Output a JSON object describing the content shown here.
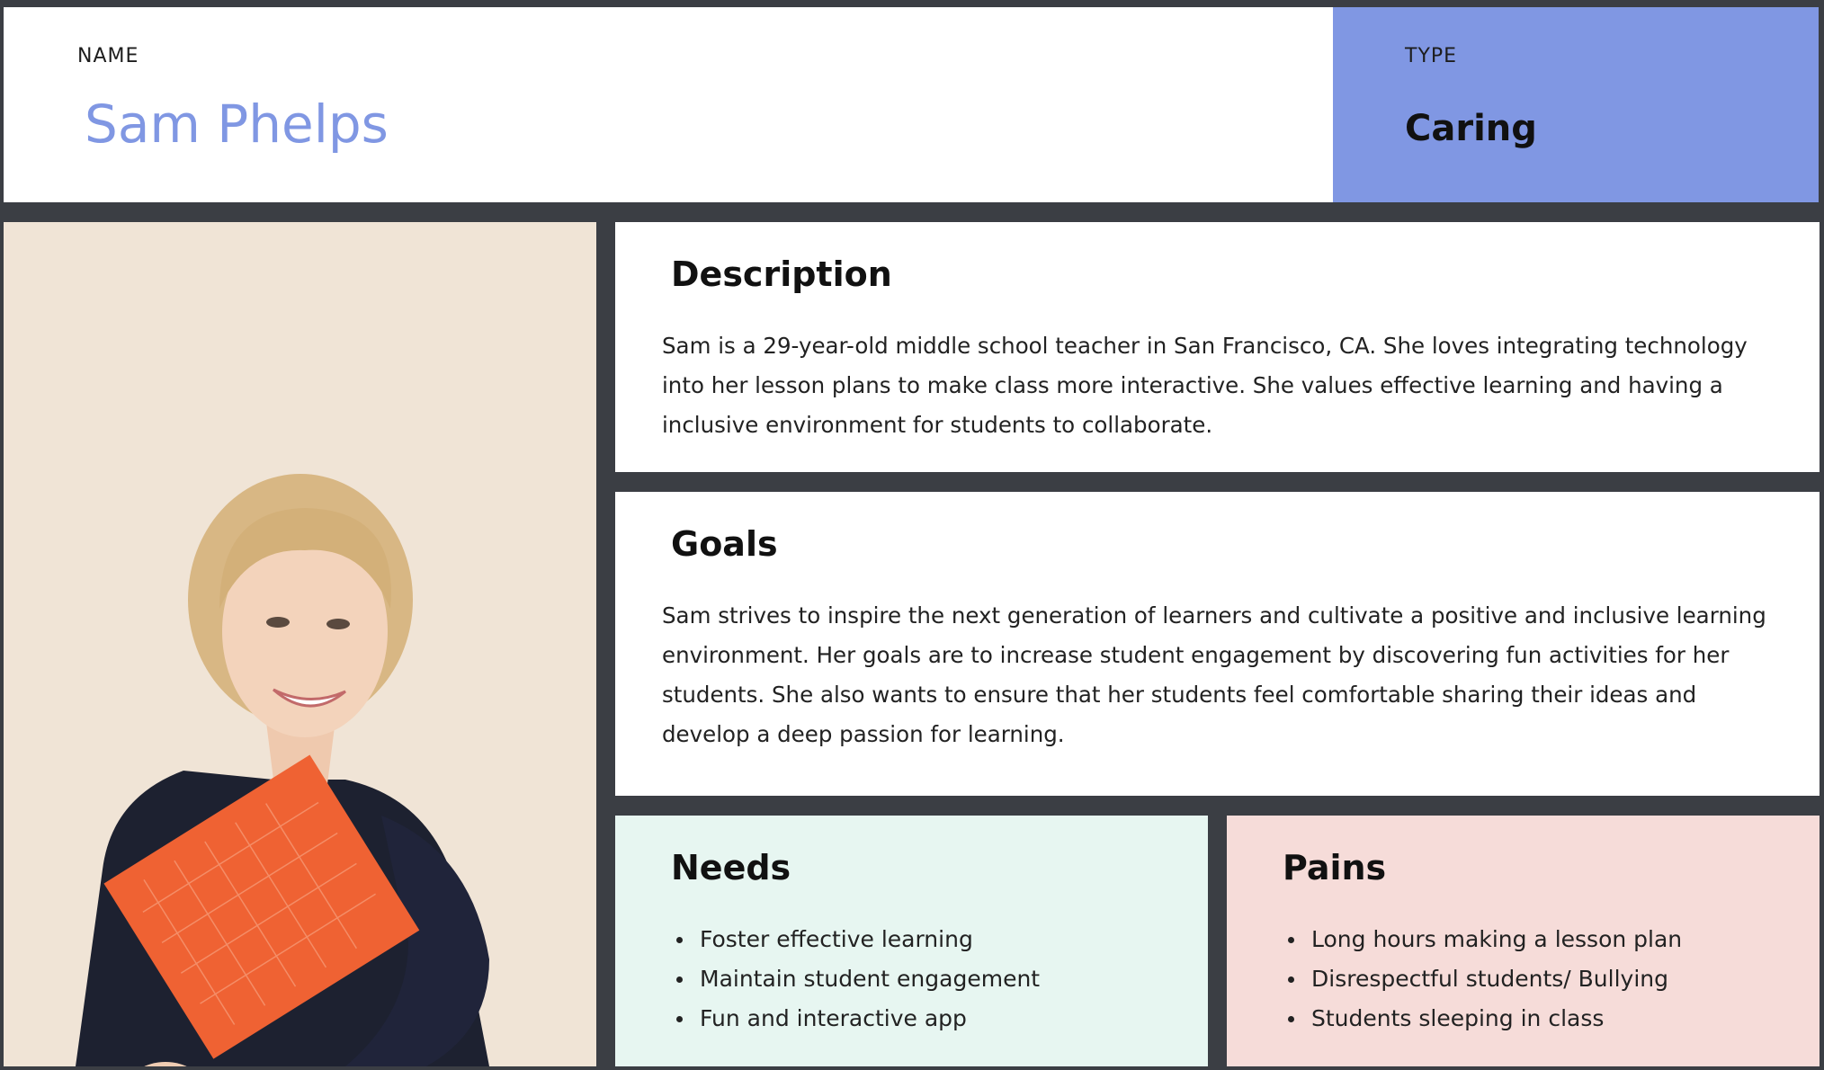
{
  "header": {
    "name_label": "NAME",
    "name_value": "Sam Phelps",
    "type_label": "TYPE",
    "type_value": "Caring"
  },
  "description": {
    "heading": "Description",
    "body": "Sam is a 29-year-old middle school teacher in San Francisco, CA. She loves integrating technology into her lesson plans to make class more interactive. She values effective learning and having a inclusive environment for students to collaborate."
  },
  "goals": {
    "heading": "Goals",
    "body": "Sam strives to inspire the next generation of learners and cultivate a positive and inclusive learning environment. Her goals are to increase student engagement by discovering fun activities for her students. She also wants to ensure that her students feel comfortable sharing their ideas and develop a deep passion for learning."
  },
  "needs": {
    "heading": "Needs",
    "items": [
      "Foster effective learning",
      "Maintain student engagement",
      "Fun and interactive app"
    ]
  },
  "pains": {
    "heading": "Pains",
    "items": [
      "Long hours making a lesson plan",
      "Disrespectful students/ Bullying",
      "Students sleeping in class"
    ]
  },
  "colors": {
    "accent": "#8097e3",
    "frame": "#3b3e44",
    "needs_bg": "#e7f6f1",
    "pains_bg": "#f6dcd9"
  }
}
